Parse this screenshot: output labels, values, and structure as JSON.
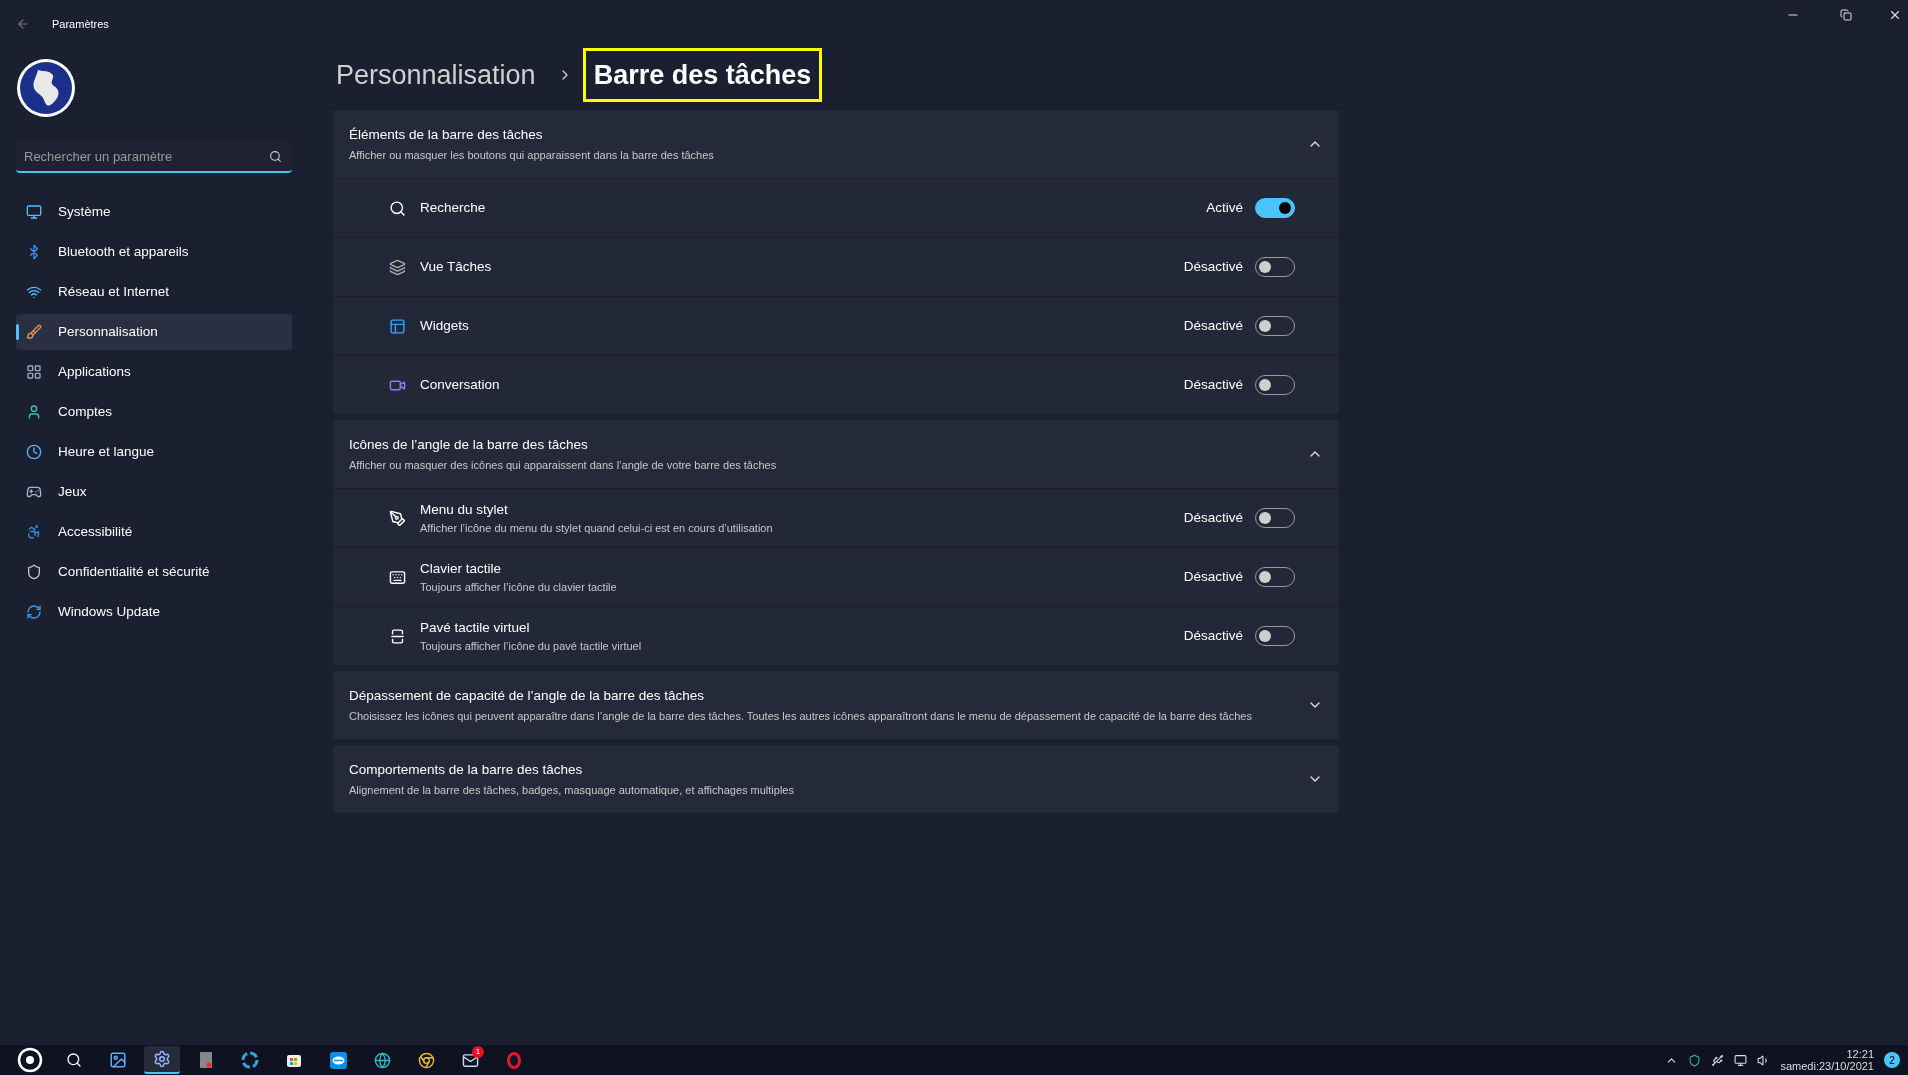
{
  "window": {
    "title": "Paramètres"
  },
  "sidebar": {
    "search": {
      "placeholder": "Rechercher un paramètre"
    },
    "items": [
      {
        "label": "Système",
        "selected": false
      },
      {
        "label": "Bluetooth et appareils",
        "selected": false
      },
      {
        "label": "Réseau et Internet",
        "selected": false
      },
      {
        "label": "Personnalisation",
        "selected": true
      },
      {
        "label": "Applications",
        "selected": false
      },
      {
        "label": "Comptes",
        "selected": false
      },
      {
        "label": "Heure et langue",
        "selected": false
      },
      {
        "label": "Jeux",
        "selected": false
      },
      {
        "label": "Accessibilité",
        "selected": false
      },
      {
        "label": "Confidentialité et sécurité",
        "selected": false
      },
      {
        "label": "Windows Update",
        "selected": false
      }
    ]
  },
  "breadcrumb": [
    {
      "label": "Personnalisation",
      "highlighted": false
    },
    {
      "label": "Barre des tâches",
      "highlighted": true
    }
  ],
  "sections": [
    {
      "title": "Éléments de la barre des tâches",
      "description": "Afficher ou masquer les boutons qui apparaissent dans la barre des tâches",
      "expanded": true,
      "rows": [
        {
          "label": "Recherche",
          "status": "Activé",
          "on": true
        },
        {
          "label": "Vue Tâches",
          "status": "Désactivé",
          "on": false
        },
        {
          "label": "Widgets",
          "status": "Désactivé",
          "on": false
        },
        {
          "label": "Conversation",
          "status": "Désactivé",
          "on": false
        }
      ]
    },
    {
      "title": "Icônes de l’angle de la barre des tâches",
      "description": "Afficher ou masquer des icônes qui apparaissent dans l’angle de votre barre des tâches",
      "expanded": true,
      "rows": [
        {
          "label": "Menu du stylet",
          "description": "Afficher l’icône du menu du stylet quand celui-ci est en cours d’utilisation",
          "status": "Désactivé",
          "on": false
        },
        {
          "label": "Clavier tactile",
          "description": "Toujours afficher l’icône du clavier tactile",
          "status": "Désactivé",
          "on": false
        },
        {
          "label": "Pavé tactile virtuel",
          "description": "Toujours afficher l’icône du pavé tactile virtuel",
          "status": "Désactivé",
          "on": false
        }
      ]
    },
    {
      "title": "Dépassement de capacité de l’angle de la barre des tâches",
      "description": "Choisissez les icônes qui peuvent apparaître dans l’angle de la barre des tâches. Toutes les autres icônes apparaîtront dans le menu de dépassement de capacité de la barre des tâches",
      "expanded": false
    },
    {
      "title": "Comportements de la barre des tâches",
      "description": "Alignement de la barre des tâches, badges, masquage automatique, et affichages multiples",
      "expanded": false
    }
  ],
  "taskbar": {
    "apps": [
      {
        "selected": false
      },
      {
        "selected": false
      },
      {
        "selected": false
      },
      {
        "selected": true
      },
      {
        "selected": false
      },
      {
        "selected": false
      },
      {
        "selected": false
      },
      {
        "selected": false
      },
      {
        "selected": false
      },
      {
        "selected": false
      },
      {
        "selected": false,
        "badge": "1"
      },
      {
        "selected": false
      }
    ],
    "time": "12:21",
    "date": "samedi:23/10/2021",
    "notifications": "2"
  }
}
